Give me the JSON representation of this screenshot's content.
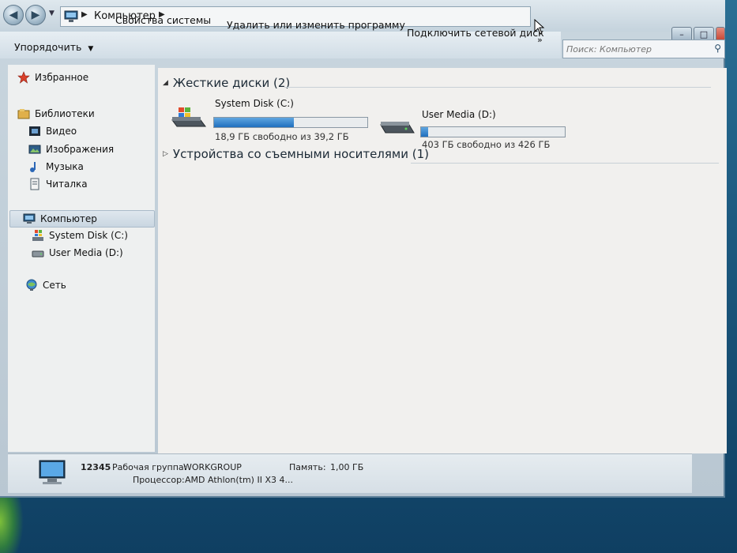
{
  "window": {
    "breadcrumb": "Компьютер",
    "search_placeholder": "Поиск: Компьютер"
  },
  "toolbar": {
    "arrange_label": "Упорядочить",
    "system_properties_label": "Свойства системы",
    "uninstall_label": "Удалить или изменить программу",
    "map_drive_label": "Подключить сетевой диск",
    "more_label": "»"
  },
  "sidebar": {
    "favorites": "Избранное",
    "libraries": "Библиотеки",
    "video": "Видео",
    "images": "Изображения",
    "music": "Музыка",
    "reader": "Читалка",
    "computer": "Компьютер",
    "drive_c": "System Disk (C:)",
    "drive_d": "User Media (D:)",
    "network": "Сеть"
  },
  "content": {
    "hard_disks_header": "Жесткие диски (2)",
    "removable_header": "Устройства со съемными носителями (1)",
    "drives": [
      {
        "name": "System Disk (C:)",
        "free_text": "18,9 ГБ свободно из 39,2 ГБ",
        "used_fraction": 0.52
      },
      {
        "name": "User Media (D:)",
        "free_text": "403 ГБ свободно из 426 ГБ",
        "used_fraction": 0.05
      }
    ]
  },
  "details": {
    "computer_name": "12345",
    "workgroup_label": "Рабочая группа:",
    "workgroup_value": "WORKGROUP",
    "memory_label": "Память:",
    "memory_value": "1,00 ГБ",
    "cpu_label": "Процессор:",
    "cpu_value": "AMD Athlon(tm) II X3 4..."
  },
  "colors": {
    "accent": "#1f6fbe",
    "close_button": "#c13d2a"
  }
}
